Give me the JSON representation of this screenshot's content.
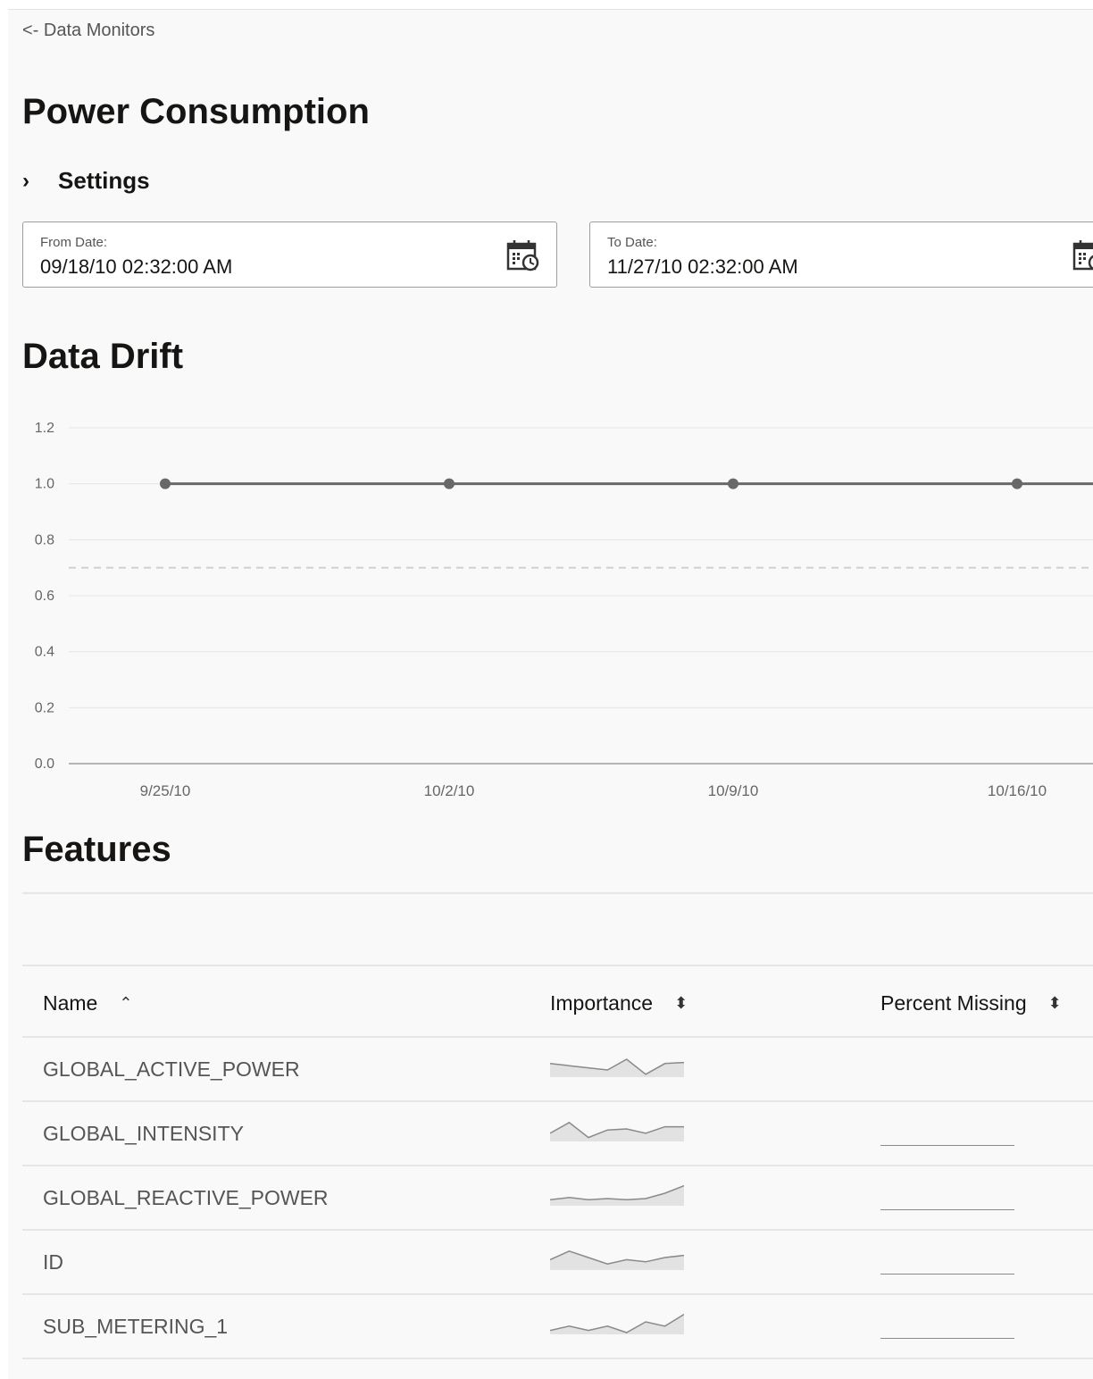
{
  "nav": {
    "back_link": "<- Data Monitors"
  },
  "page": {
    "title": "Power Consumption"
  },
  "settings": {
    "label": "Settings"
  },
  "dates": {
    "from_label": "From Date:",
    "from_value": "09/18/10 02:32:00 AM",
    "to_label": "To Date:",
    "to_value": "11/27/10 02:32:00 AM"
  },
  "icons": {
    "calendar": "calendar-clock-icon",
    "expand": "chevron-right-icon",
    "sort": "sort-icon"
  },
  "colors": {
    "line": "#686868",
    "grid": "#e6e6e6",
    "threshold": "#cfcfcf",
    "text_muted": "#555555"
  },
  "data_drift": {
    "heading": "Data Drift",
    "chart_data": {
      "type": "line",
      "title": "",
      "xlabel": "",
      "ylabel": "",
      "ylim": [
        0,
        1.2
      ],
      "y_ticks": [
        "0.0",
        "0.2",
        "0.4",
        "0.6",
        "0.8",
        "1.0",
        "1.2"
      ],
      "x_ticks": [
        "9/25/10",
        "10/2/10",
        "10/9/10",
        "10/16/10"
      ],
      "series": [
        {
          "values": [
            1.0,
            1.0,
            1.0,
            1.0
          ]
        }
      ],
      "threshold": 0.7,
      "grid": true
    }
  },
  "features": {
    "heading": "Features",
    "columns": {
      "name": "Name",
      "importance": "Importance",
      "percent_missing": "Percent Missing"
    },
    "rows": [
      {
        "name": "GLOBAL_ACTIVE_POWER",
        "importance_trend": [
          0.55,
          0.45,
          0.35,
          0.25,
          0.75,
          0.05,
          0.55,
          0.6
        ],
        "missing_shown": false
      },
      {
        "name": "GLOBAL_INTENSITY",
        "importance_trend": [
          0.3,
          0.8,
          0.1,
          0.45,
          0.5,
          0.3,
          0.6,
          0.6
        ],
        "missing_shown": true
      },
      {
        "name": "GLOBAL_REACTIVE_POWER",
        "importance_trend": [
          0.2,
          0.3,
          0.2,
          0.25,
          0.2,
          0.25,
          0.5,
          0.85
        ],
        "missing_shown": true
      },
      {
        "name": "ID",
        "importance_trend": [
          0.4,
          0.8,
          0.5,
          0.2,
          0.4,
          0.3,
          0.5,
          0.6
        ],
        "missing_shown": true
      },
      {
        "name": "SUB_METERING_1",
        "importance_trend": [
          0.1,
          0.3,
          0.1,
          0.3,
          0.0,
          0.5,
          0.3,
          0.85
        ],
        "missing_shown": true
      }
    ]
  }
}
